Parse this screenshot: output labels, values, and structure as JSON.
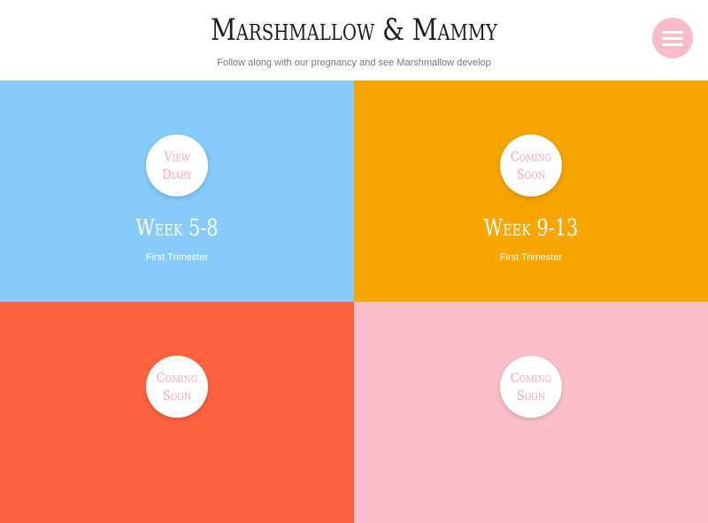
{
  "header": {
    "title": "Marshmallow & Mammy",
    "subtitle": "Follow along with our pregnancy and see Marshmallow develop"
  },
  "menu": {
    "icon": "hamburger-icon",
    "color": "#f8bbc8"
  },
  "tiles": [
    {
      "badge": "View Diary",
      "title": "Week 5-8",
      "subtitle": "First Trimester",
      "color": "#87cbfb"
    },
    {
      "badge": "Coming Soon",
      "title": "Week 9-13",
      "subtitle": "First Trimester",
      "color": "#f8a500"
    },
    {
      "badge": "Coming Soon",
      "title": "",
      "subtitle": "",
      "color": "#fe6340"
    },
    {
      "badge": "Coming Soon",
      "title": "",
      "subtitle": "",
      "color": "#fbbfcc"
    }
  ]
}
